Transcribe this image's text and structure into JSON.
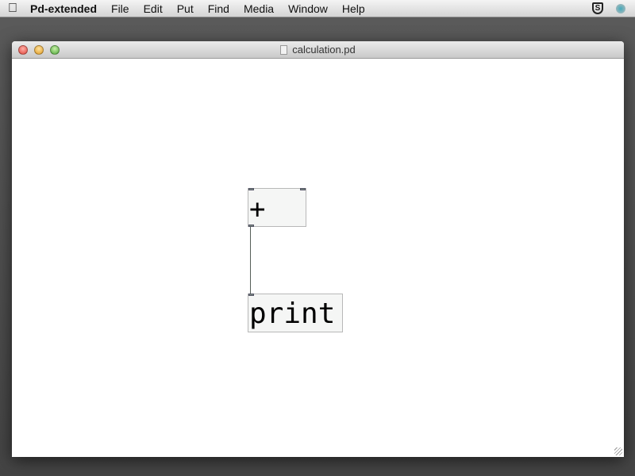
{
  "menubar": {
    "apple_icon": "apple-logo",
    "app_name": "Pd-extended",
    "items": [
      "File",
      "Edit",
      "Put",
      "Find",
      "Media",
      "Window",
      "Help"
    ],
    "status_icons": [
      "shield-s-icon",
      "webcam-icon"
    ]
  },
  "window": {
    "title": "calculation.pd",
    "doc_icon": "pd-document-icon"
  },
  "canvas": {
    "objects": [
      {
        "text": "+"
      },
      {
        "text": "print"
      }
    ],
    "connections": [
      {
        "from": "+",
        "to": "print"
      }
    ]
  }
}
